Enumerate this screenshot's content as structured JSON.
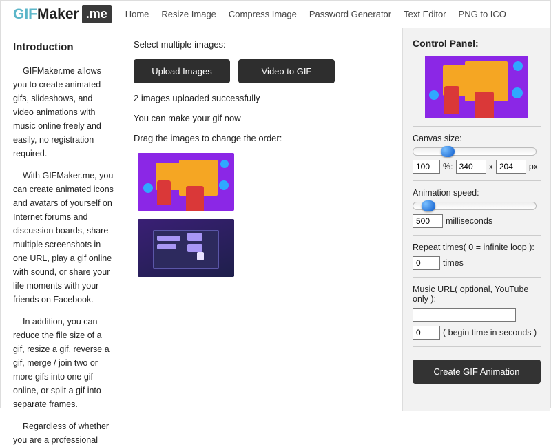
{
  "logo": {
    "part1": "GIF",
    "part2": "Maker",
    "part3": ".me"
  },
  "nav": {
    "home": "Home",
    "resize": "Resize Image",
    "compress": "Compress Image",
    "password": "Password Generator",
    "text_editor": "Text Editor",
    "png_ico": "PNG to ICO"
  },
  "intro": {
    "title": "Introduction",
    "p1": "GIFMaker.me allows you to create animated gifs, slideshows, and video animations with music online freely and easily, no registration required.",
    "p2": "With GIFMaker.me, you can create animated icons and avatars of yourself on Internet forums and discussion boards, share multiple screenshots in one URL, play a gif online with sound, or share your life moments with your friends on Facebook.",
    "p3": "In addition, you can reduce the file size of a gif, resize a gif, reverse a gif, merge / join two or more gifs into one gif online, or split a gif into separate frames.",
    "p4": "Regardless of whether you are a professional"
  },
  "mid": {
    "select_label": "Select multiple images:",
    "upload_btn": "Upload Images",
    "video_btn": "Video to GIF",
    "status": "2 images uploaded successfully",
    "ready": "You can make your gif now",
    "drag": "Drag the images to change the order:"
  },
  "panel": {
    "title": "Control Panel:",
    "canvas_label": "Canvas size:",
    "canvas_pct": "100",
    "pct_sym": "%:",
    "canvas_w": "340",
    "x_sym": "x",
    "canvas_h": "204",
    "px_sym": "px",
    "speed_label": "Animation speed:",
    "speed_val": "500",
    "speed_unit": "milliseconds",
    "repeat_label": "Repeat times( 0 = infinite loop ):",
    "repeat_val": "0",
    "repeat_unit": "times",
    "music_label": "Music URL( optional, YouTube only ):",
    "music_url": "",
    "begin_val": "0",
    "begin_label": "( begin time in seconds )",
    "create_btn": "Create GIF Animation"
  }
}
